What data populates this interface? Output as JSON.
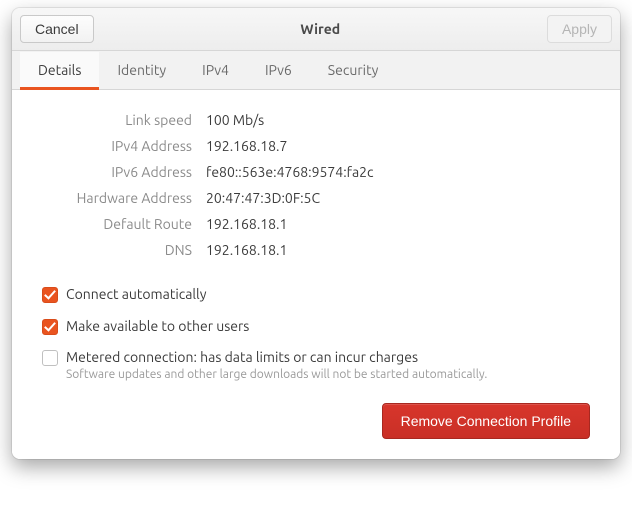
{
  "titlebar": {
    "cancel": "Cancel",
    "title": "Wired",
    "apply": "Apply"
  },
  "tabs": {
    "details": "Details",
    "identity": "Identity",
    "ipv4": "IPv4",
    "ipv6": "IPv6",
    "security": "Security"
  },
  "details": {
    "link_speed_label": "Link speed",
    "link_speed_value": "100 Mb/s",
    "ipv4_label": "IPv4 Address",
    "ipv4_value": "192.168.18.7",
    "ipv6_label": "IPv6 Address",
    "ipv6_value": "fe80::563e:4768:9574:fa2c",
    "hw_label": "Hardware Address",
    "hw_value": "20:47:47:3D:0F:5C",
    "route_label": "Default Route",
    "route_value": "192.168.18.1",
    "dns_label": "DNS",
    "dns_value": "192.168.18.1"
  },
  "checks": {
    "connect_auto": "Connect automatically",
    "make_available": "Make available to other users",
    "metered": "Metered connection: has data limits or can incur charges",
    "metered_sub": "Software updates and other large downloads will not be started automatically."
  },
  "footer": {
    "remove": "Remove Connection Profile"
  }
}
